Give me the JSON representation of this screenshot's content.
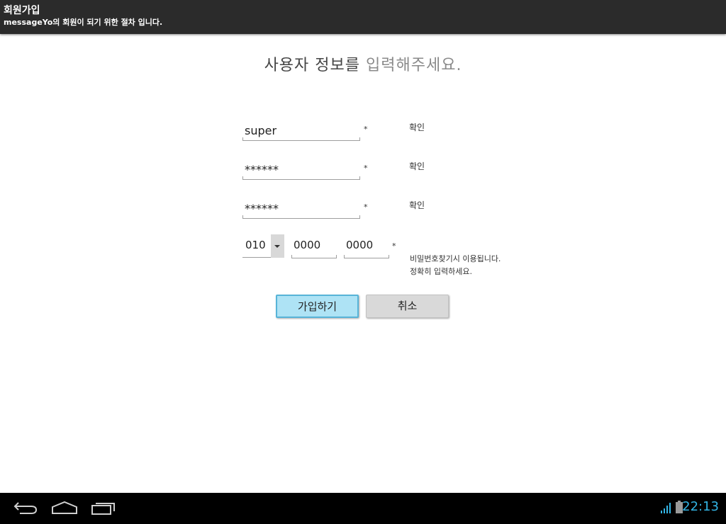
{
  "titlebar": {
    "title": "회원가입",
    "subtitle": "messageYo의 회원이 되기 위한 절차 입니다."
  },
  "heading": {
    "part1": "사용자 정보를",
    "part2": "입력해주세요."
  },
  "form": {
    "user_id": {
      "value": "super",
      "required_mark": "*",
      "confirm_label": "확인"
    },
    "password": {
      "value": "******",
      "required_mark": "*",
      "confirm_label": "확인"
    },
    "password_confirm": {
      "value": "******",
      "required_mark": "*",
      "confirm_label": "확인"
    },
    "phone": {
      "prefix_selected": "010",
      "middle": "0000",
      "last": "0000",
      "required_mark": "*",
      "hint_line1": "비밀번호찾기시 이용됩니다.",
      "hint_line2": "정확히 입력하세요."
    }
  },
  "buttons": {
    "signup": "가입하기",
    "cancel": "취소"
  },
  "navbar": {
    "icons": [
      "back-icon",
      "home-icon",
      "recent-apps-icon",
      "signal-icon",
      "battery-icon"
    ],
    "clock": "22:13",
    "accent": "#33b5e5"
  }
}
